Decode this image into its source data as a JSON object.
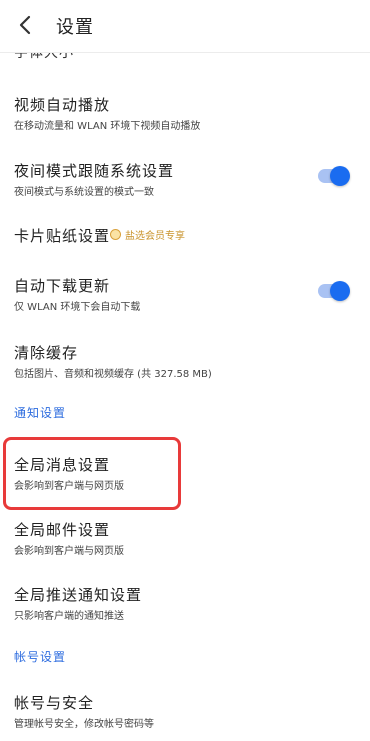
{
  "header": {
    "title": "设置",
    "back_icon": "chevron-left-icon"
  },
  "cutoff_item": {
    "label": "字体大小"
  },
  "rows": {
    "video_autoplay": {
      "title": "视频自动播放",
      "subtitle": "在移动流量和 WLAN 环境下视频自动播放"
    },
    "night_mode": {
      "title": "夜间模式跟随系统设置",
      "subtitle": "夜间模式与系统设置的模式一致",
      "toggle_on": true
    },
    "card_sticker": {
      "title": "卡片贴纸设置",
      "badge": "盐选会员专享",
      "badge_icon": "coin-icon"
    },
    "auto_update": {
      "title": "自动下载更新",
      "subtitle": "仅 WLAN 环境下会自动下载",
      "toggle_on": true
    },
    "clear_cache": {
      "title": "清除缓存",
      "subtitle": "包括图片、音频和视频缓存 (共 327.58 MB)"
    },
    "global_message": {
      "title": "全局消息设置",
      "subtitle": "会影响到客户端与网页版"
    },
    "global_mail": {
      "title": "全局邮件设置",
      "subtitle": "会影响到客户端与网页版"
    },
    "global_push": {
      "title": "全局推送通知设置",
      "subtitle": "只影响客户端的通知推送"
    },
    "account_security": {
      "title": "帐号与安全",
      "subtitle": "管理帐号安全，修改帐号密码等"
    }
  },
  "sections": {
    "notifications": "通知设置",
    "account": "帐号设置"
  },
  "colors": {
    "accent": "#2d6cdf",
    "toggle_on": "#1a6cf0",
    "highlight": "#e83a3a",
    "badge": "#c9932b"
  }
}
